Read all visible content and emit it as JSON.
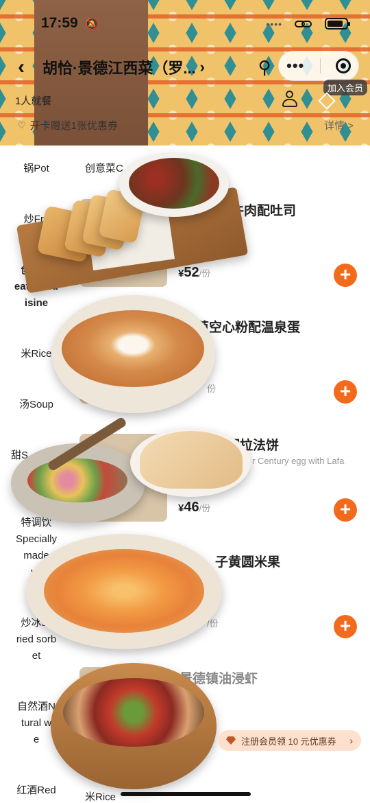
{
  "status": {
    "time": "17:59",
    "signal": "••••"
  },
  "header": {
    "store_title": "胡恰·景德江西菜（罗...",
    "join_member": "加入会员",
    "party_size": "1人就餐",
    "promo": "开卡赠送1张优惠券",
    "details": "详情 >"
  },
  "sidebar": {
    "items": [
      {
        "label": "锅Pot"
      },
      {
        "label": "炒Fry"
      },
      {
        "label": "创意菜"
      },
      {
        "label": "eative cu"
      },
      {
        "label": "isine"
      },
      {
        "label": "米Rice"
      },
      {
        "label": "汤Soup"
      },
      {
        "label": "甜S"
      },
      {
        "label": "特调饮"
      },
      {
        "label": "Specially"
      },
      {
        "label": "made"
      },
      {
        "label": "ve"
      },
      {
        "label": "炒冰sti"
      },
      {
        "label": "ried sorb"
      },
      {
        "label": "et"
      },
      {
        "label": "自然酒N"
      },
      {
        "label": "tural w"
      },
      {
        "label": "e"
      },
      {
        "label": "红酒Red"
      }
    ],
    "top_tab": "创意菜C"
  },
  "products": [
    {
      "name": "椒牛肉配吐司",
      "sub": "",
      "price": "52",
      "currency": "¥",
      "unit": "/份"
    },
    {
      "name": "芦空心粉配温泉蛋",
      "sub": "",
      "price": "",
      "currency": "",
      "unit": "份"
    },
    {
      "name": "蛋配拉法饼",
      "sub": "r Century egg with Lafa",
      "price": "46",
      "currency": "¥",
      "unit": "/份"
    },
    {
      "name": "子黄圆米果",
      "sub": "",
      "price": "",
      "currency": "",
      "unit": "/份"
    },
    {
      "name": "景德镇油浸虾",
      "sub": "",
      "price": "",
      "currency": "",
      "unit": ""
    }
  ],
  "bottom_label": "米Rice",
  "toast": {
    "text": "注册会员领 10 元优惠券"
  },
  "colors": {
    "accent": "#f26b1d",
    "toast_bg": "#fde0cd"
  }
}
